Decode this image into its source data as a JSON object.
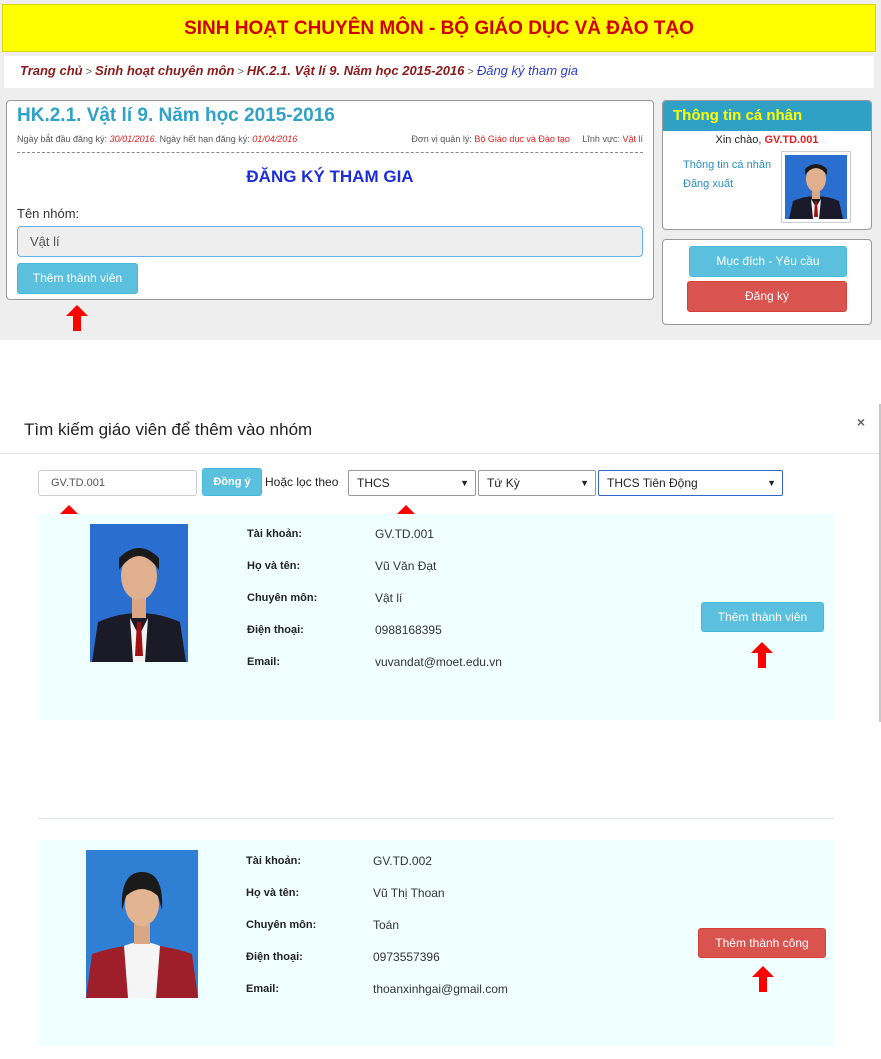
{
  "banner": {
    "title": "SINH HOẠT CHUYÊN MÔN - BỘ GIÁO DỤC VÀ ĐÀO TẠO"
  },
  "breadcrumb": {
    "home": "Trang chủ",
    "section": "Sinh hoạt chuyên môn",
    "course": "HK.2.1. Vật lí 9. Năm học 2015-2016",
    "current": "Đăng ký tham gia",
    "separator": ">"
  },
  "course": {
    "title": "HK.2.1. Vật lí 9. Năm học 2015-2016",
    "start_label": "Ngày bắt đầu đăng ký:",
    "start_date": "30/01/2016",
    "end_label": "Ngày hết hạn đăng ký:",
    "end_date": "01/04/2016",
    "unit_label": "Đơn vị quản lý:",
    "unit_value": "Bộ Giáo dục và Đào tạo",
    "field_label": "Lĩnh vực:",
    "field_value": "Vật lí"
  },
  "register": {
    "heading": "ĐĂNG KÝ THAM GIA",
    "group_label": "Tên nhóm:",
    "group_value": "Vật lí",
    "add_member_button": "Thêm thành viên"
  },
  "profile": {
    "header": "Thông tin cá nhân",
    "greeting": "Xin chào,",
    "username": "GV.TD.001",
    "info_link": "Thông tin cá nhân",
    "logout_link": "Đăng xuất"
  },
  "side_actions": {
    "purpose_button": "Mục đích - Yêu cầu",
    "register_button": "Đăng ký"
  },
  "modal": {
    "title": "Tìm kiếm giáo viên để thêm vào nhóm",
    "close": "×",
    "search_value": "GV.TD.001",
    "agree_button": "Đồng ý",
    "filter_label": "Hoặc lọc theo",
    "filter_level": "THCS",
    "filter_district": "Tứ Kỳ",
    "filter_school": "THCS Tiên Động"
  },
  "labels": {
    "account": "Tài khoản:",
    "name": "Họ và tên:",
    "subject": "Chuyên môn:",
    "phone": "Điện thoại:",
    "email": "Email:"
  },
  "results": [
    {
      "account": "GV.TD.001",
      "name": "Vũ Văn Đạt",
      "subject": "Vật lí",
      "phone": "0988168395",
      "email": "vuvandat@moet.edu.vn",
      "button": "Thêm thành viên"
    },
    {
      "account": "GV.TD.002",
      "name": "Vũ Thị Thoan",
      "subject": "Toán",
      "phone": "0973557396",
      "email": "thoanxinhgai@gmail.com",
      "button": "Thêm thành công"
    }
  ],
  "colors": {
    "banner_bg": "#ffff00",
    "banner_text": "#d00000",
    "info_button": "#5bc0de",
    "danger_button": "#d9534f",
    "card_bg": "#f0ffff",
    "arrow": "#ff0000"
  }
}
